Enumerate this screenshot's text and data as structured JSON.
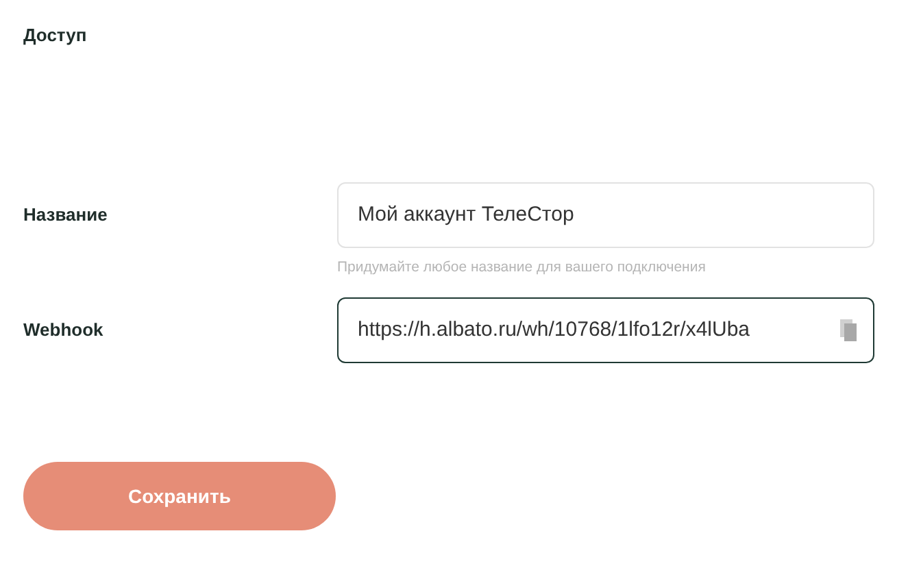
{
  "section_title": "Доступ",
  "fields": [
    {
      "label": "Название",
      "value": "Мой аккаунт ТелеСтор",
      "hint": "Придумайте любое название для вашего подключения",
      "focused": false,
      "copyable": false
    },
    {
      "label": "Webhook",
      "value": "https://h.albato.ru/wh/10768/1lfo12r/x4lUba",
      "focused": true,
      "copyable": true
    }
  ],
  "save_button": "Сохранить"
}
